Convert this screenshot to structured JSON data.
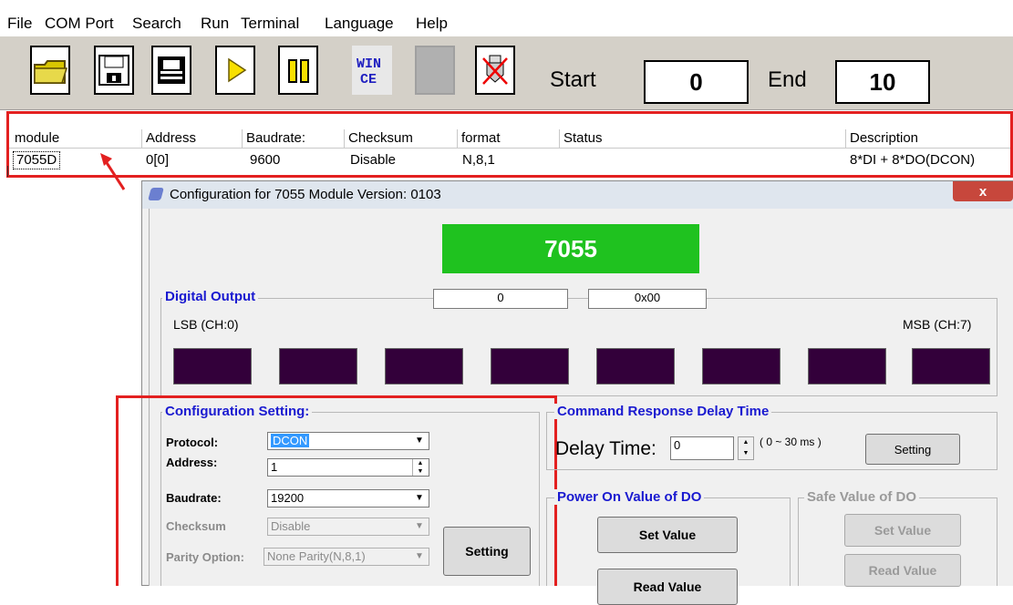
{
  "menu": [
    "File",
    "COM Port",
    "Search",
    "Run",
    "Terminal",
    "Language",
    "Help"
  ],
  "toolbar": {
    "buttons": [
      "folder-icon",
      "floppy-disk-icon",
      "printer-icon",
      "play-icon",
      "pause-icon",
      "wince-icon",
      "blank-icon",
      "disconnect-icon"
    ],
    "wince_text": "WIN CE",
    "start_label": "Start",
    "start_value": "0",
    "end_label": "End",
    "end_value": "10"
  },
  "module_table": {
    "columns": [
      "module",
      "Address",
      "Baudrate:",
      "Checksum",
      "format",
      "Status",
      "Description"
    ],
    "rows": [
      {
        "module": "7055D",
        "address": "0[0]",
        "baudrate": "9600",
        "checksum": "Disable",
        "format": "N,8,1",
        "status": "",
        "description": "8*DI + 8*DO(DCON)"
      }
    ]
  },
  "dialog": {
    "title": "Configuration for 7055 Module Version: 0103",
    "close": "x",
    "module_name": "7055",
    "module_color": "#1fc21f",
    "digital_output": {
      "legend": "Digital Output",
      "decimal_value": "0",
      "hex_value": "0x00",
      "lsb_label": "LSB (CH:0)",
      "msb_label": "MSB (CH:7)",
      "channel_states": [
        false,
        false,
        false,
        false,
        false,
        false,
        false,
        false
      ]
    },
    "config": {
      "legend": "Configuration Setting:",
      "protocol_label": "Protocol:",
      "protocol_value": "DCON",
      "address_label": "Address:",
      "address_value": "1",
      "baudrate_label": "Baudrate:",
      "baudrate_value": "19200",
      "checksum_label": "Checksum",
      "checksum_value": "Disable",
      "parity_label": "Parity Option:",
      "parity_value": "None Parity(N,8,1)",
      "setting_button": "Setting"
    },
    "delay": {
      "legend": "Command Response Delay Time",
      "label": "Delay Time:",
      "value": "0",
      "range": "( 0 ~ 30 ms )",
      "setting_button": "Setting"
    },
    "power_on": {
      "legend": "Power On Value of DO",
      "set_button": "Set Value",
      "read_button": "Read Value"
    },
    "safe_value": {
      "legend": "Safe Value of DO",
      "set_button": "Set Value",
      "read_button": "Read Value"
    }
  },
  "colors": {
    "highlight_box": "#e32020",
    "led_off": "#33003a",
    "legend_text": "#1a1ad0",
    "toolbar_bg": "#d4d0c8"
  }
}
